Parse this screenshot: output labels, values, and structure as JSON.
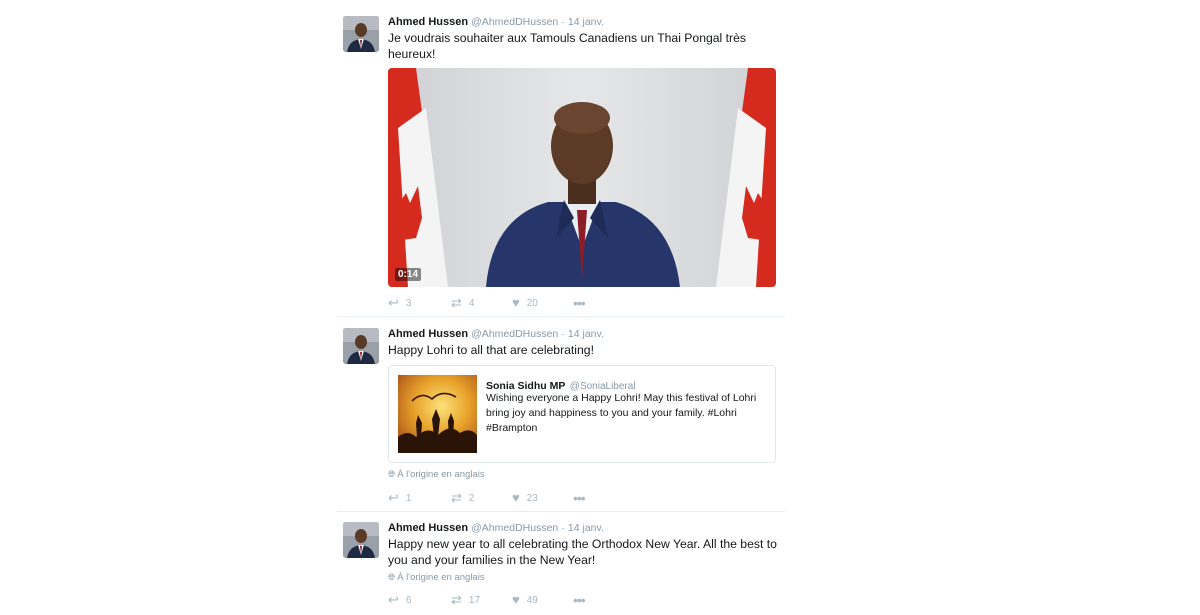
{
  "tweets": [
    {
      "author": "Ahmed Hussen",
      "handle": "@AhmedDHussen",
      "sep": "·",
      "time": "14 janv.",
      "text": "Je voudrais souhaiter aux Tamouls Canadiens un Thai Pongal très heureux!",
      "video_duration": "0:14",
      "replies": "3",
      "retweets": "4",
      "likes": "20"
    },
    {
      "author": "Ahmed Hussen",
      "handle": "@AhmedDHussen",
      "sep": "·",
      "time": "14 janv.",
      "text": "Happy Lohri to all that are celebrating!",
      "quote": {
        "author": "Sonia Sidhu MP",
        "handle": "@SoniaLiberal",
        "text": "Wishing everyone a Happy Lohri! May this festival of Lohri bring joy and happiness to you and your family. #Lohri #Brampton"
      },
      "translation_note": "À l'origine en anglais",
      "replies": "1",
      "retweets": "2",
      "likes": "23"
    },
    {
      "author": "Ahmed Hussen",
      "handle": "@AhmedDHussen",
      "sep": "·",
      "time": "14 janv.",
      "text": "Happy new year to all celebrating the Orthodox New Year. All the best to you and your families in the New Year!",
      "translation_note": "À l'origine en anglais",
      "replies": "6",
      "retweets": "17",
      "likes": "49"
    }
  ],
  "icons": {
    "reply": "reply-icon",
    "retweet": "retweet-icon",
    "like": "heart-icon",
    "more": "more-icon",
    "globe": "globe-icon"
  },
  "colors": {
    "text": "#14171a",
    "muted": "#8899a6",
    "action": "#aab8c2",
    "flag_red": "#d52b1e"
  }
}
